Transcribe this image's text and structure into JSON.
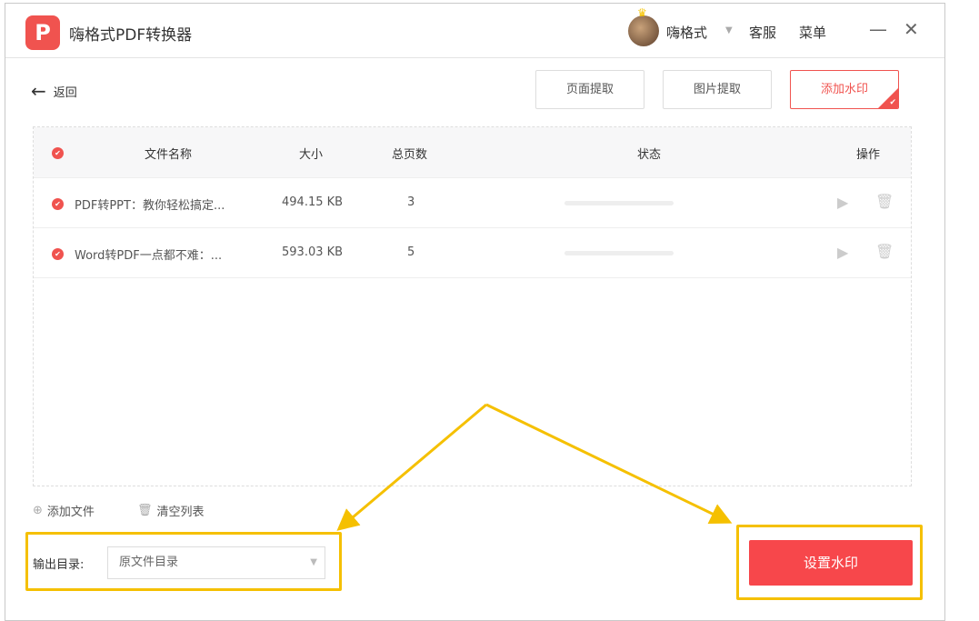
{
  "app": {
    "title": "嗨格式PDF转换器",
    "logo_letter": "P",
    "user": "嗨格式",
    "support": "客服",
    "menu": "菜单"
  },
  "nav": {
    "back": "返回"
  },
  "tabs": [
    {
      "label": "页面提取"
    },
    {
      "label": "图片提取"
    },
    {
      "label": "添加水印",
      "active": true
    }
  ],
  "table": {
    "headers": {
      "name": "文件名称",
      "size": "大小",
      "pages": "总页数",
      "status": "状态",
      "action": "操作"
    },
    "rows": [
      {
        "name": "PDF转PPT：教你轻松搞定...",
        "size": "494.15 KB",
        "pages": "3",
        "progress": 0
      },
      {
        "name": "Word转PDF一点都不难：...",
        "size": "593.03 KB",
        "pages": "5",
        "progress": 0
      }
    ]
  },
  "footer": {
    "add_file": "添加文件",
    "clear_list": "清空列表",
    "output_label": "输出目录:",
    "output_value": "原文件目录",
    "submit": "设置水印"
  },
  "colors": {
    "accent": "#f0534f",
    "highlight": "#f5c000"
  }
}
